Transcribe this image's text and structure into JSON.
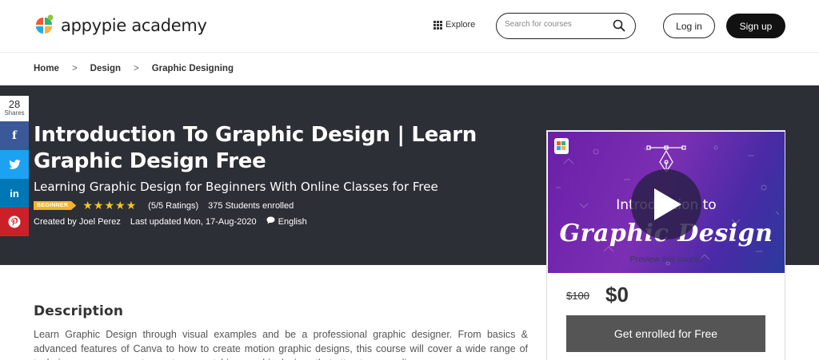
{
  "header": {
    "logo_text": "appypie academy",
    "explore_label": "Explore",
    "search_placeholder": "Search for courses",
    "login_label": "Log in",
    "signup_label": "Sign up"
  },
  "breadcrumb": [
    "Home",
    "Design",
    "Graphic Designing"
  ],
  "share": {
    "count": "28",
    "label": "Shares"
  },
  "course": {
    "title": "Introduction To Graphic Design | Learn Graphic Design Free",
    "subtitle": "Learning Graphic Design for Beginners With Online Classes for Free",
    "level_badge": "BEGINNER",
    "rating_value": 5,
    "rating_max": 5,
    "ratings_text": "(5/5 Ratings)",
    "students_text": "375 Students enrolled",
    "created_by": "Created by Joel Perez",
    "last_updated": "Last updated Mon, 17-Aug-2020",
    "language": "English"
  },
  "card": {
    "preview_intro": "Introduction to",
    "preview_graphic": "Graphic Design",
    "preview_text": "Preview this course",
    "price_old": "$100",
    "price_new": "$0",
    "enroll_label": "Get enrolled for Free"
  },
  "description": {
    "heading": "Description",
    "text": "Learn Graphic Design through visual examples and be a professional graphic designer. From basics & advanced features of Canva to how to create motion graphic designs, this course will cover a wide range of techniques you can use to create eye-catching graphic designs that attract your audience."
  },
  "colors": {
    "hero_bg": "#2c2f36",
    "badge": "#f0b429",
    "star": "#f5c518",
    "enroll_bg": "#555555",
    "facebook": "#3b5998",
    "twitter": "#1da1f2",
    "linkedin": "#0077b5",
    "pinterest": "#cb2027"
  }
}
